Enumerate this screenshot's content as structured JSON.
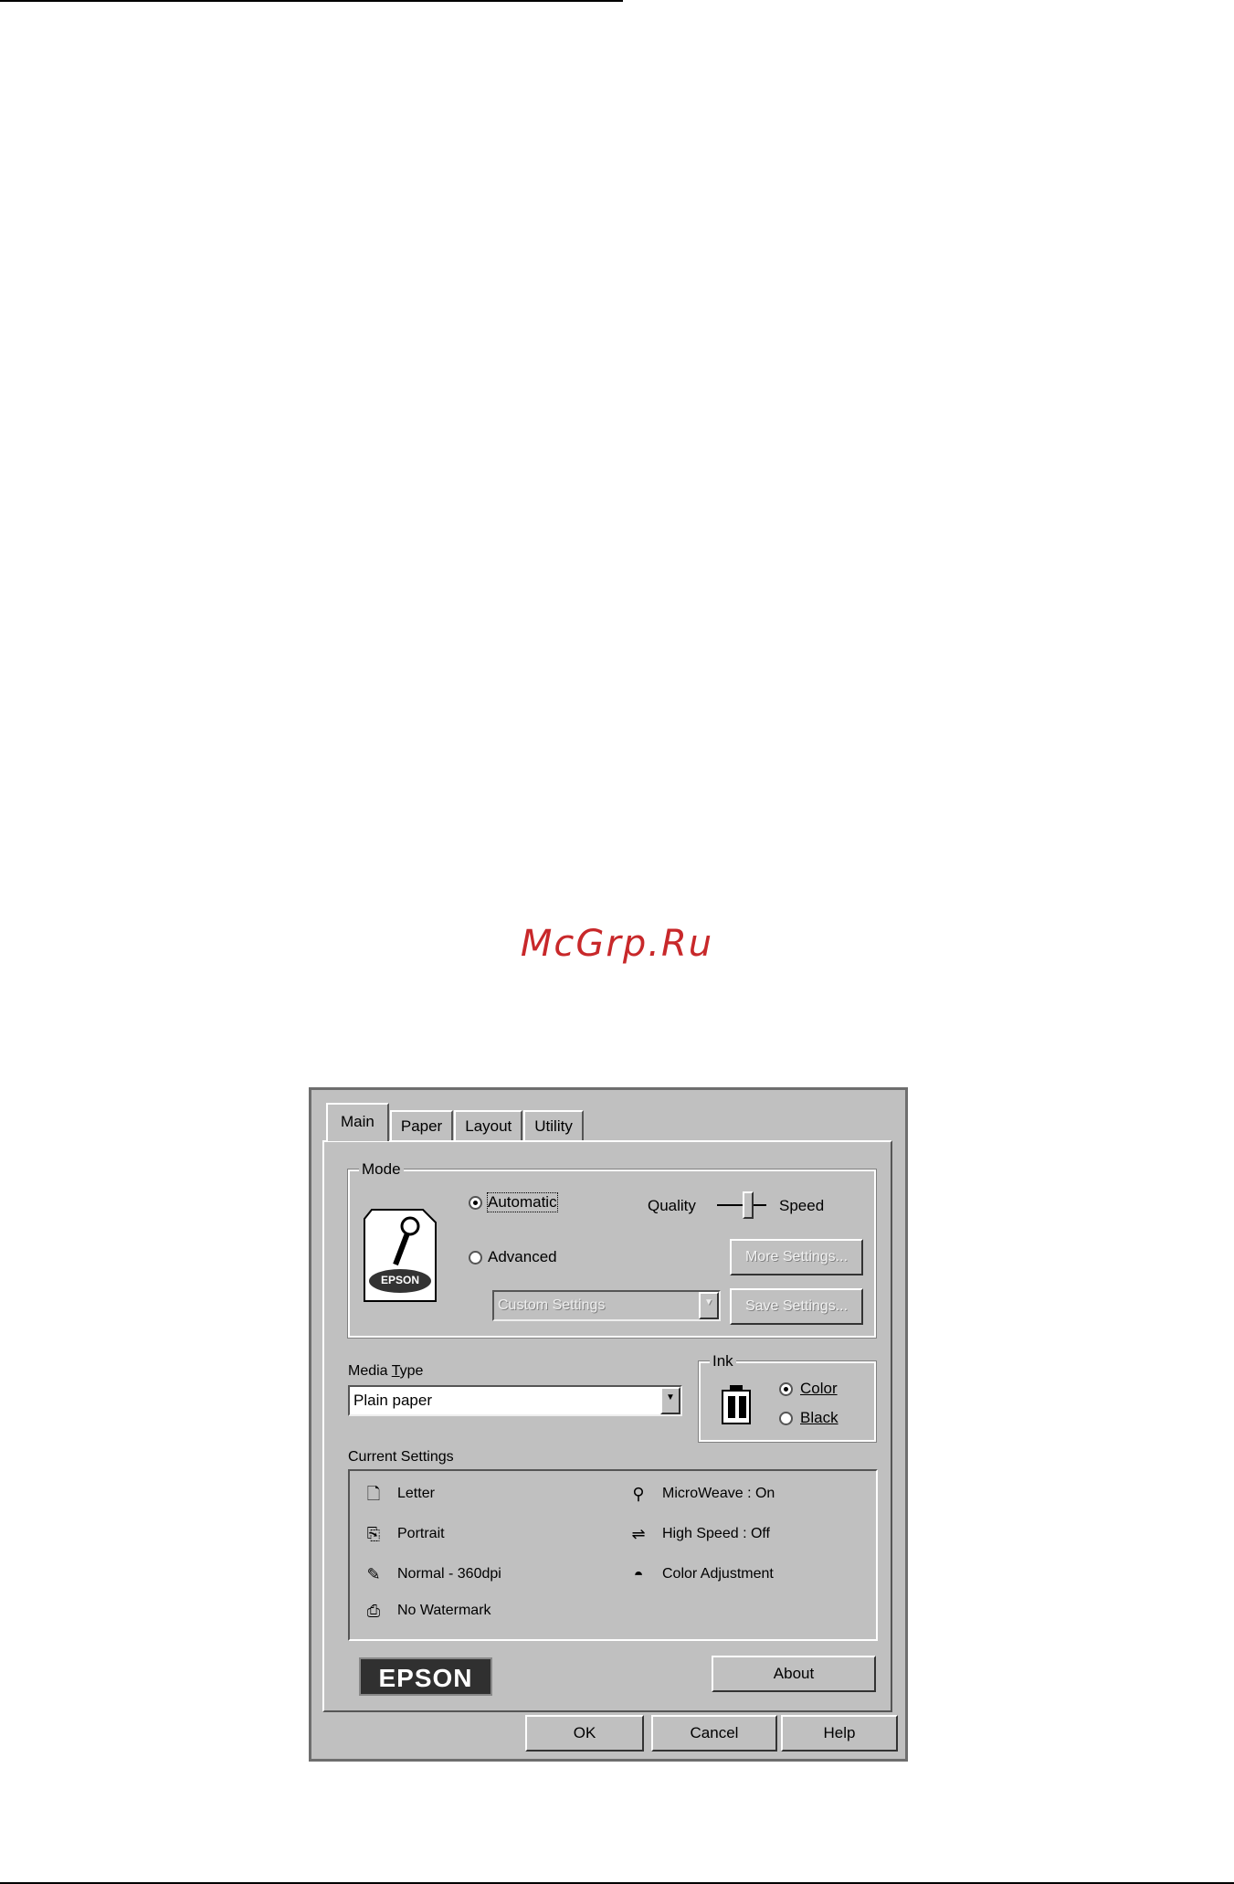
{
  "watermark": "McGrp.Ru",
  "tabs": [
    "Main",
    "Paper",
    "Layout",
    "Utility"
  ],
  "mode": {
    "group_label": "Mode",
    "automatic_label": "Automatic",
    "advanced_label": "Advanced",
    "selected": "Automatic",
    "quality_label": "Quality",
    "speed_label": "Speed",
    "more_settings_label": "More Settings...",
    "save_settings_label": "Save Settings...",
    "custom_settings_value": "Custom Settings",
    "printer_logo_text": "EPSON"
  },
  "media": {
    "label_pre": "Media ",
    "label_underlined": "T",
    "label_post": "ype",
    "value": "Plain paper"
  },
  "ink": {
    "group_label": "Ink",
    "color_label": "Color",
    "black_label": "Black",
    "selected": "Color"
  },
  "current_settings": {
    "label": "Current Settings",
    "left": [
      {
        "icon": "paper-size-icon",
        "text": "Letter"
      },
      {
        "icon": "orientation-icon",
        "text": "Portrait"
      },
      {
        "icon": "quality-icon",
        "text": "Normal - 360dpi"
      },
      {
        "icon": "watermark-icon",
        "text": "No Watermark"
      }
    ],
    "right": [
      {
        "icon": "microweave-icon",
        "text": "MicroWeave : On"
      },
      {
        "icon": "high-speed-icon",
        "text": "High Speed : Off"
      },
      {
        "icon": "color-adjustment-icon",
        "text": "Color Adjustment"
      }
    ]
  },
  "brand_logo": "EPSON",
  "about_label": "About",
  "footer": {
    "ok": "OK",
    "cancel": "Cancel",
    "help": "Help"
  },
  "colors": {
    "dialog_bg": "#c0c0c0",
    "watermark": "#c8282a",
    "logo_bg": "#303030"
  }
}
